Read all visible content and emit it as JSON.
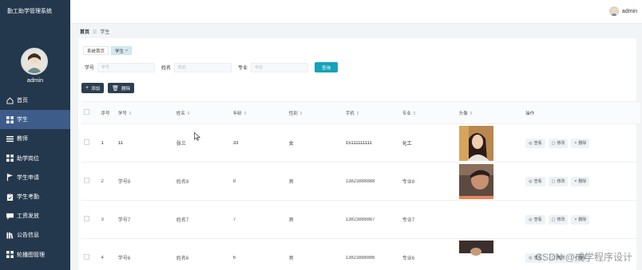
{
  "sidebar": {
    "brand": "勤工助学管理系统",
    "username": "admin",
    "items": [
      {
        "label": "首页",
        "icon": "home-icon",
        "active": false
      },
      {
        "label": "学生",
        "icon": "grid-icon",
        "active": true
      },
      {
        "label": "教师",
        "icon": "list-icon",
        "active": false
      },
      {
        "label": "助学岗位",
        "icon": "grid-icon",
        "active": false
      },
      {
        "label": "学生申请",
        "icon": "flag-icon",
        "active": false
      },
      {
        "label": "学生考勤",
        "icon": "clipboard-icon",
        "active": false
      },
      {
        "label": "工资发放",
        "icon": "chat-icon",
        "active": false
      },
      {
        "label": "公告信息",
        "icon": "book-icon",
        "active": false
      },
      {
        "label": "轮播图管理",
        "icon": "grid-icon",
        "active": false
      }
    ]
  },
  "topbar": {
    "username": "admin"
  },
  "breadcrumb": {
    "home": "首页",
    "separator": "☰",
    "current": "学生"
  },
  "tabs": [
    {
      "label": "系统首页",
      "active": false
    },
    {
      "label": "学生",
      "active": true,
      "close": "×"
    }
  ],
  "filters": {
    "student_no_label": "学号",
    "student_no_placeholder": "学号",
    "name_label": "姓名",
    "name_placeholder": "姓名",
    "major_label": "专业",
    "major_placeholder": "专业",
    "search_label": "查询"
  },
  "actions": {
    "add_label": "添加",
    "delete_label": "删除"
  },
  "table": {
    "headers": [
      "序号",
      "学号",
      "姓名",
      "年龄",
      "性别",
      "手机",
      "专业",
      "头像",
      "操作"
    ],
    "rows": [
      {
        "index": "1",
        "no": "11",
        "name": "张三",
        "age": "33",
        "gender": "女",
        "phone": "15111111111",
        "major": "化工",
        "photo": "girl"
      },
      {
        "index": "2",
        "no": "学号8",
        "name": "姓名8",
        "age": "8",
        "gender": "男",
        "phone": "13823888888",
        "major": "专业8",
        "photo": "boy"
      },
      {
        "index": "3",
        "no": "学号7",
        "name": "姓名7",
        "age": "7",
        "gender": "男",
        "phone": "13823888887",
        "major": "专业7",
        "photo": "none"
      },
      {
        "index": "4",
        "no": "学号6",
        "name": "姓名6",
        "age": "6",
        "gender": "男",
        "phone": "13823888886",
        "major": "专业6",
        "photo": "partial"
      }
    ],
    "ops": {
      "view": "查看",
      "edit": "修改",
      "delete": "删除"
    }
  },
  "watermark": "CSDN @成学程序设计"
}
